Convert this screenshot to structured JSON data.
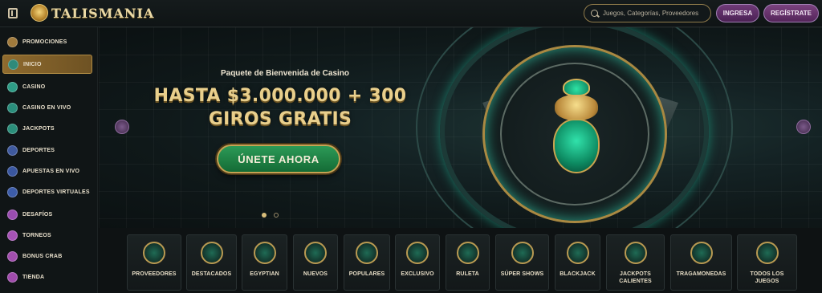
{
  "header": {
    "logo_text": "TALISMANIA",
    "search_placeholder": "Juegos, Categorías, Proveedores",
    "login_label": "INGRESA",
    "register_label": "REGÍSTRATE"
  },
  "sidebar": {
    "items": [
      {
        "label": "PROMOCIONES",
        "icon": "gift-icon",
        "color": "#a07a3c"
      },
      {
        "label": "INICIO",
        "icon": "home-icon",
        "color": "#2f8a7a",
        "active": true
      },
      {
        "label": "CASINO",
        "icon": "chip-icon",
        "color": "#2e9c86"
      },
      {
        "label": "CASINO EN VIVO",
        "icon": "live-dealer-icon",
        "color": "#2a8e7c"
      },
      {
        "label": "JACKPOTS",
        "icon": "jackpot-icon",
        "color": "#2b8f7b"
      },
      {
        "label": "DEPORTES",
        "icon": "sports-ball-icon",
        "color": "#3f5a9e"
      },
      {
        "label": "APUESTAS EN VIVO",
        "icon": "live-bet-icon",
        "color": "#3a57a0"
      },
      {
        "label": "DEPORTES VIRTUALES",
        "icon": "virtual-sports-icon",
        "color": "#3c5ca8"
      },
      {
        "label": "DESAFÍOS",
        "icon": "challenge-icon",
        "color": "#9a4db0"
      },
      {
        "label": "TORNEOS",
        "icon": "trophy-icon",
        "color": "#a653b6"
      },
      {
        "label": "BONUS CRAB",
        "icon": "crab-icon",
        "color": "#a24fae"
      },
      {
        "label": "TIENDA",
        "icon": "shop-icon",
        "color": "#a04cac"
      }
    ]
  },
  "hero": {
    "subtitle": "Paquete de Bienvenida de Casino",
    "headline_line1": "HASTA $3.000.000 + 300",
    "headline_line2": "GIROS GRATIS",
    "cta_label": "ÚNETE AHORA"
  },
  "categories": [
    {
      "label": "PROVEEDORES",
      "icon": "scroll-icon"
    },
    {
      "label": "DESTACADOS",
      "icon": "scarab-icon"
    },
    {
      "label": "EGYPTIAN",
      "icon": "eye-of-horus-icon"
    },
    {
      "label": "NUEVOS",
      "icon": "sun-disc-icon"
    },
    {
      "label": "POPULARES",
      "icon": "crown-icon"
    },
    {
      "label": "EXCLUSIVO",
      "icon": "pharaoh-icon"
    },
    {
      "label": "RULETA",
      "icon": "roulette-icon"
    },
    {
      "label": "SÚPER SHOWS",
      "icon": "show-wheel-icon"
    },
    {
      "label": "BLACKJACK",
      "icon": "spade-icon"
    },
    {
      "label": "JACKPOTS CALIENTES",
      "icon": "flame-icon"
    },
    {
      "label": "TRAGAMONEDAS",
      "icon": "slot-machine-icon"
    },
    {
      "label": "TODOS LOS JUEGOS",
      "icon": "lotus-icon"
    }
  ]
}
